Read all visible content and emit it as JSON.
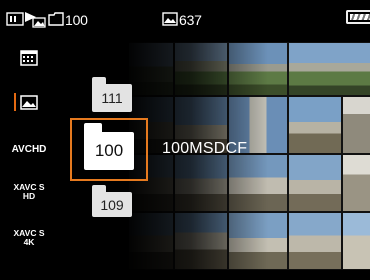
{
  "status": {
    "folder_number": "100",
    "image_count": "637",
    "battery_icon": "battery-icon"
  },
  "menu": {
    "items": [
      {
        "id": "calendar",
        "icon": "calendar-icon"
      },
      {
        "id": "still",
        "icon": "still-image-icon",
        "selected": true
      },
      {
        "id": "avchd",
        "label": "AVCHD"
      },
      {
        "id": "xavc_hd",
        "line1": "XAVC S",
        "line2": "HD"
      },
      {
        "id": "xavc_4k",
        "line1": "XAVC S",
        "line2": "4K"
      }
    ]
  },
  "folders": {
    "prev": "111",
    "current": "100",
    "next": "109",
    "current_name": "100MSDCF"
  },
  "colors": {
    "accent": "#e67a1f",
    "background": "#000000",
    "text": "#ffffff"
  }
}
